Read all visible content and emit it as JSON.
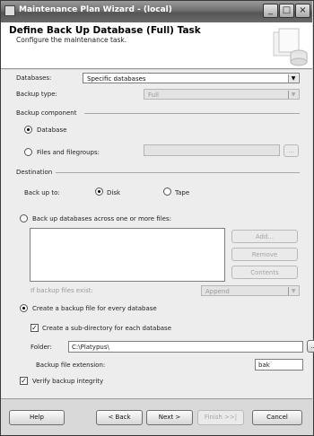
{
  "window": {
    "title": "Maintenance Plan Wizard - (local)"
  },
  "title_buttons": {
    "minimize": "_",
    "maximize": "□",
    "close": "×"
  },
  "header": {
    "title": "Define Back Up Database (Full) Task",
    "subtitle": "Configure the maintenance task."
  },
  "databases": {
    "label": "Databases:",
    "value": "Specific databases"
  },
  "backup_type": {
    "label": "Backup type:",
    "value": "Full"
  },
  "backup_component": {
    "heading": "Backup component",
    "database_label": "Database",
    "files_label": "Files and filegroups:",
    "browse_label": "..."
  },
  "destination": {
    "heading": "Destination",
    "backup_to_label": "Back up to:",
    "disk_label": "Disk",
    "tape_label": "Tape",
    "across_files_label": "Back up databases across one or more files:",
    "add_label": "Add...",
    "remove_label": "Remove",
    "contents_label": "Contents",
    "if_exist_label": "If backup files exist:",
    "if_exist_value": "Append",
    "per_db_label": "Create a backup file for every database",
    "subdir_label": "Create a sub-directory for each database",
    "folder_label": "Folder:",
    "folder_value": "C:\\Platypus\\",
    "folder_browse": "...",
    "ext_label": "Backup file extension:",
    "ext_value": "bak",
    "verify_label": "Verify backup integrity"
  },
  "footer": {
    "help": "Help",
    "back": "< Back",
    "next": "Next >",
    "finish": "Finish >>|",
    "cancel": "Cancel"
  }
}
